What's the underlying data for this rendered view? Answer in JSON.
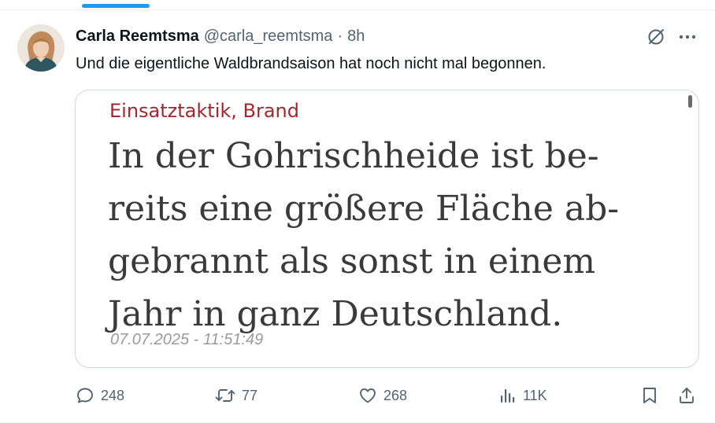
{
  "tweet": {
    "author_name": "Carla Reemtsma",
    "handle": "@carla_reemtsma",
    "separator": "·",
    "time": "8h",
    "text": "Und die eigentliche Waldbrandsaison hat noch nicht mal begonnen."
  },
  "media": {
    "category": "Einsatztaktik, Brand",
    "headline_lines": [
      "In der Gohrischheide ist be-",
      "reits eine größere Fläche ab-",
      "gebrannt als sonst in einem",
      "Jahr in ganz Deutschland."
    ],
    "date": "07.07.2025 - 11:51:49"
  },
  "actions": {
    "replies": "248",
    "reposts": "77",
    "likes": "268",
    "views": "11K"
  },
  "colors": {
    "accent": "#1d9bf0",
    "secondary_text": "#536471",
    "category_red": "#a2272f",
    "headline_gray": "#3a3a3a"
  },
  "icons": [
    "grok-icon",
    "more-icon",
    "reply-icon",
    "repost-icon",
    "like-icon",
    "views-icon",
    "bookmark-icon",
    "share-icon"
  ]
}
